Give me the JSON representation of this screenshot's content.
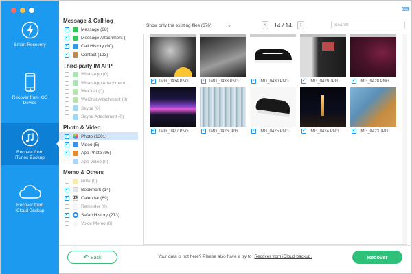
{
  "nav": {
    "items": [
      {
        "label": "Smart Recovery",
        "icon": "bolt-icon"
      },
      {
        "label": "Recover from iOS Device",
        "icon": "phone-icon"
      },
      {
        "label": "Recover from iTunes Backup",
        "icon": "music-note-icon"
      },
      {
        "label": "Recover from iCloud Backup",
        "icon": "cloud-icon"
      }
    ]
  },
  "categories": {
    "message": {
      "title": "Message & Call log",
      "items": [
        {
          "label": "Message (88)",
          "icon": "message-icon"
        },
        {
          "label": "Message Attachment (",
          "icon": "message-attachment-icon"
        },
        {
          "label": "Call History (90)",
          "icon": "call-history-icon"
        },
        {
          "label": "Contact (123)",
          "icon": "contact-icon"
        }
      ]
    },
    "im": {
      "title": "Third-party IM APP",
      "items": [
        {
          "label": "WhatsApp (0)",
          "icon": "whatsapp-icon"
        },
        {
          "label": "WhatsApp Attachment...",
          "icon": "whatsapp-attachment-icon"
        },
        {
          "label": "WeChat (0)",
          "icon": "wechat-icon"
        },
        {
          "label": "WeChat Attachment (0)",
          "icon": "wechat-attachment-icon"
        },
        {
          "label": "Skype (0)",
          "icon": "skype-icon"
        },
        {
          "label": "Skype Attachment (0)",
          "icon": "skype-attachment-icon"
        }
      ]
    },
    "photo": {
      "title": "Photo & Video",
      "items": [
        {
          "label": "Photo (1301)",
          "icon": "photo-icon"
        },
        {
          "label": "Video (5)",
          "icon": "video-icon"
        },
        {
          "label": "App Photo (95)",
          "icon": "app-photo-icon"
        },
        {
          "label": "App Video (0)",
          "icon": "app-video-icon"
        }
      ]
    },
    "memo": {
      "title": "Memo & Others",
      "items": [
        {
          "label": "Note (0)",
          "icon": "note-icon"
        },
        {
          "label": "Bookmark (14)",
          "icon": "bookmark-icon"
        },
        {
          "label": "Calendar (69)",
          "icon": "calendar-icon"
        },
        {
          "label": "Reminder (0)",
          "icon": "reminder-icon"
        },
        {
          "label": "Safari History (273)",
          "icon": "safari-icon"
        },
        {
          "label": "Voice Memo (0)",
          "icon": "voice-memo-icon"
        }
      ]
    },
    "calendar_day": "24"
  },
  "toolbar": {
    "filter_label": "Show only the existing files (676)",
    "page_label": "14 / 14",
    "search_placeholder": "Search"
  },
  "gallery": {
    "row1": [
      {
        "name": "IMG_0434.PNG"
      },
      {
        "name": "IMG_0433.PNG"
      },
      {
        "name": "IMG_0430.PNG"
      },
      {
        "name": "IMG_0429.JPG"
      },
      {
        "name": "IMG_0428.PNG"
      }
    ],
    "row2": [
      {
        "name": "IMG_0427.PNG"
      },
      {
        "name": "IMG_0426.JPG"
      },
      {
        "name": "IMG_0425.PNG"
      },
      {
        "name": "IMG_0424.PNG"
      },
      {
        "name": "IMG_0423.JPG"
      }
    ]
  },
  "footer": {
    "back_label": "Back",
    "hint_text": "Your data is not here? Please also have a try to",
    "hint_link": "Recover from iCloud backup.",
    "recover_label": "Recover"
  },
  "colors": {
    "sidebar": "#1b9af0",
    "sidebar_active": "#0d7fd4",
    "accent_green": "#2fc07a",
    "selection": "#d3e6fa"
  }
}
